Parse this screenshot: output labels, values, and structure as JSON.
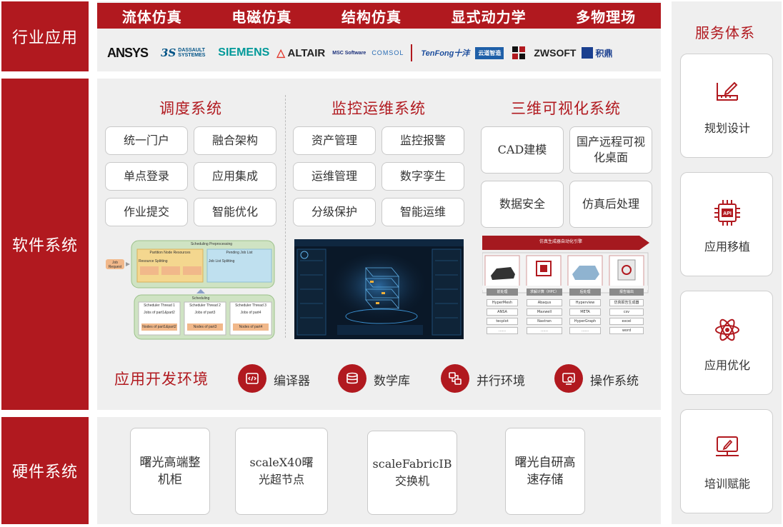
{
  "rows": {
    "industry": "行业应用",
    "software": "软件系统",
    "hardware": "硬件系统"
  },
  "industry_tabs": [
    "流体仿真",
    "电磁仿真",
    "结构仿真",
    "显式动力学",
    "多物理场"
  ],
  "logos": [
    "ANSYS",
    "DASSAULT SYSTEMES",
    "SIEMENS",
    "ALTAIR",
    "MSC Software",
    "COMSOL",
    "TenFong十沣",
    "云道智造",
    "",
    "ZWSOFT",
    "积鼎"
  ],
  "software": {
    "scheduling": {
      "title": "调度系统",
      "items": [
        "统一门户",
        "融合架构",
        "单点登录",
        "应用集成",
        "作业提交",
        "智能优化"
      ]
    },
    "monitoring": {
      "title": "监控运维系统",
      "items": [
        "资产管理",
        "监控报警",
        "运维管理",
        "数字孪生",
        "分级保护",
        "智能运维"
      ]
    },
    "visualization": {
      "title": "三维可视化系统",
      "items": [
        "CAD建模",
        "国产远程可视化桌面",
        "数据安全",
        "仿真后处理"
      ]
    }
  },
  "scheduling_diagram": {
    "title": "Scheduling Preprocessing",
    "left_box": "Partition Node Resources",
    "left_sub": "Resource Splitting",
    "right_box": "Pending Job List",
    "right_sub": "Job List Splitting",
    "request": "Job Request",
    "scheduling": "Scheduling",
    "threads": [
      "Scheduler Thread 1",
      "Scheduler Thread 2",
      "Scheduler Thread 3"
    ],
    "jobs": [
      "Jobs of part1&part2",
      "Jobs of part3",
      "Jobs of part4"
    ],
    "nodes": [
      "Nodes of part1&part2",
      "Nodes of part3",
      "Nodes of part4"
    ]
  },
  "viz_diagram": {
    "banner": "仿真生成器自动化引擎",
    "stages": [
      "前处理",
      "求解计算（HPC）",
      "后处理",
      "报告输出"
    ],
    "col1": [
      "HyperMesh",
      "ANSA",
      "tecplot",
      "……"
    ],
    "col2": [
      "Abaqus",
      "Maxwell",
      "Nastran",
      "……"
    ],
    "col3": [
      "Hyperview",
      "META",
      "HyperGraph",
      "……"
    ],
    "col4": [
      "仿真报告生成器",
      "csv",
      "excel",
      "word"
    ]
  },
  "dev_env": {
    "title": "应用开发环境",
    "items": [
      {
        "label": "编译器",
        "icon": "code-icon"
      },
      {
        "label": "数学库",
        "icon": "database-icon"
      },
      {
        "label": "并行环境",
        "icon": "parallel-icon"
      },
      {
        "label": "操作系统",
        "icon": "os-icon"
      }
    ]
  },
  "hardware": [
    "曙光高端整机柜",
    "scaleX40曙光超节点",
    "scaleFabricIB交换机",
    "曙光自研高速存储"
  ],
  "services": {
    "title": "服务体系",
    "items": [
      {
        "label": "规划设计",
        "icon": "ruler-pencil-icon"
      },
      {
        "label": "应用移植",
        "icon": "api-chip-icon"
      },
      {
        "label": "应用优化",
        "icon": "atom-icon"
      },
      {
        "label": "培训赋能",
        "icon": "monitor-pen-icon"
      }
    ]
  },
  "colors": {
    "accent": "#b1191f",
    "panel": "#efefef"
  }
}
